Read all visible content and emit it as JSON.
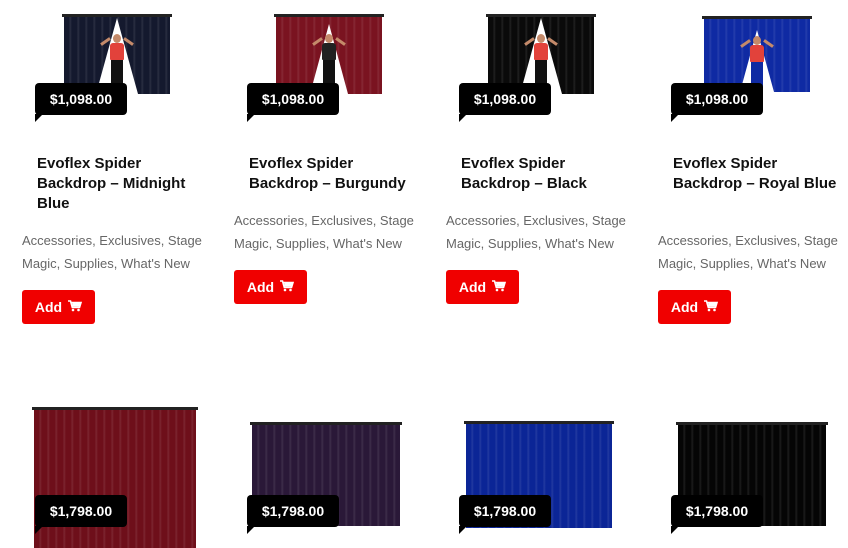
{
  "products": [
    {
      "price": "$1,098.00",
      "title": "Evoflex Spider Backdrop – Midnight Blue",
      "categories": "Accessories, Exclusives, Stage Magic, Supplies, What's New",
      "add_label": "Add",
      "curtain_color": "#14192e",
      "has_person": true
    },
    {
      "price": "$1,098.00",
      "title": "Evoflex Spider Backdrop – Burgundy",
      "categories": "Accessories, Exclusives, Stage Magic, Supplies, What's New",
      "add_label": "Add",
      "curtain_color": "#7a1320",
      "has_person": true
    },
    {
      "price": "$1,098.00",
      "title": "Evoflex Spider Backdrop – Black",
      "categories": "Accessories, Exclusives, Stage Magic, Supplies, What's New",
      "add_label": "Add",
      "curtain_color": "#0a0a0a",
      "has_person": true
    },
    {
      "price": "$1,098.00",
      "title": "Evoflex Spider Backdrop – Royal Blue",
      "categories": "Accessories, Exclusives, Stage Magic, Supplies, What's New",
      "add_label": "Add",
      "curtain_color": "#0f2aa3",
      "has_person": true
    },
    {
      "price": "$1,798.00",
      "curtain_color": "#6e0f1a",
      "has_person": false
    },
    {
      "price": "$1,798.00",
      "curtain_color": "#2a1838",
      "has_person": false
    },
    {
      "price": "$1,798.00",
      "curtain_color": "#0b2596",
      "has_person": false
    },
    {
      "price": "$1,798.00",
      "curtain_color": "#050505",
      "has_person": false
    }
  ],
  "colors": {
    "accent_red": "#f00000",
    "price_bg": "#000000"
  },
  "icons": {
    "cart": "shopping-cart-icon"
  }
}
